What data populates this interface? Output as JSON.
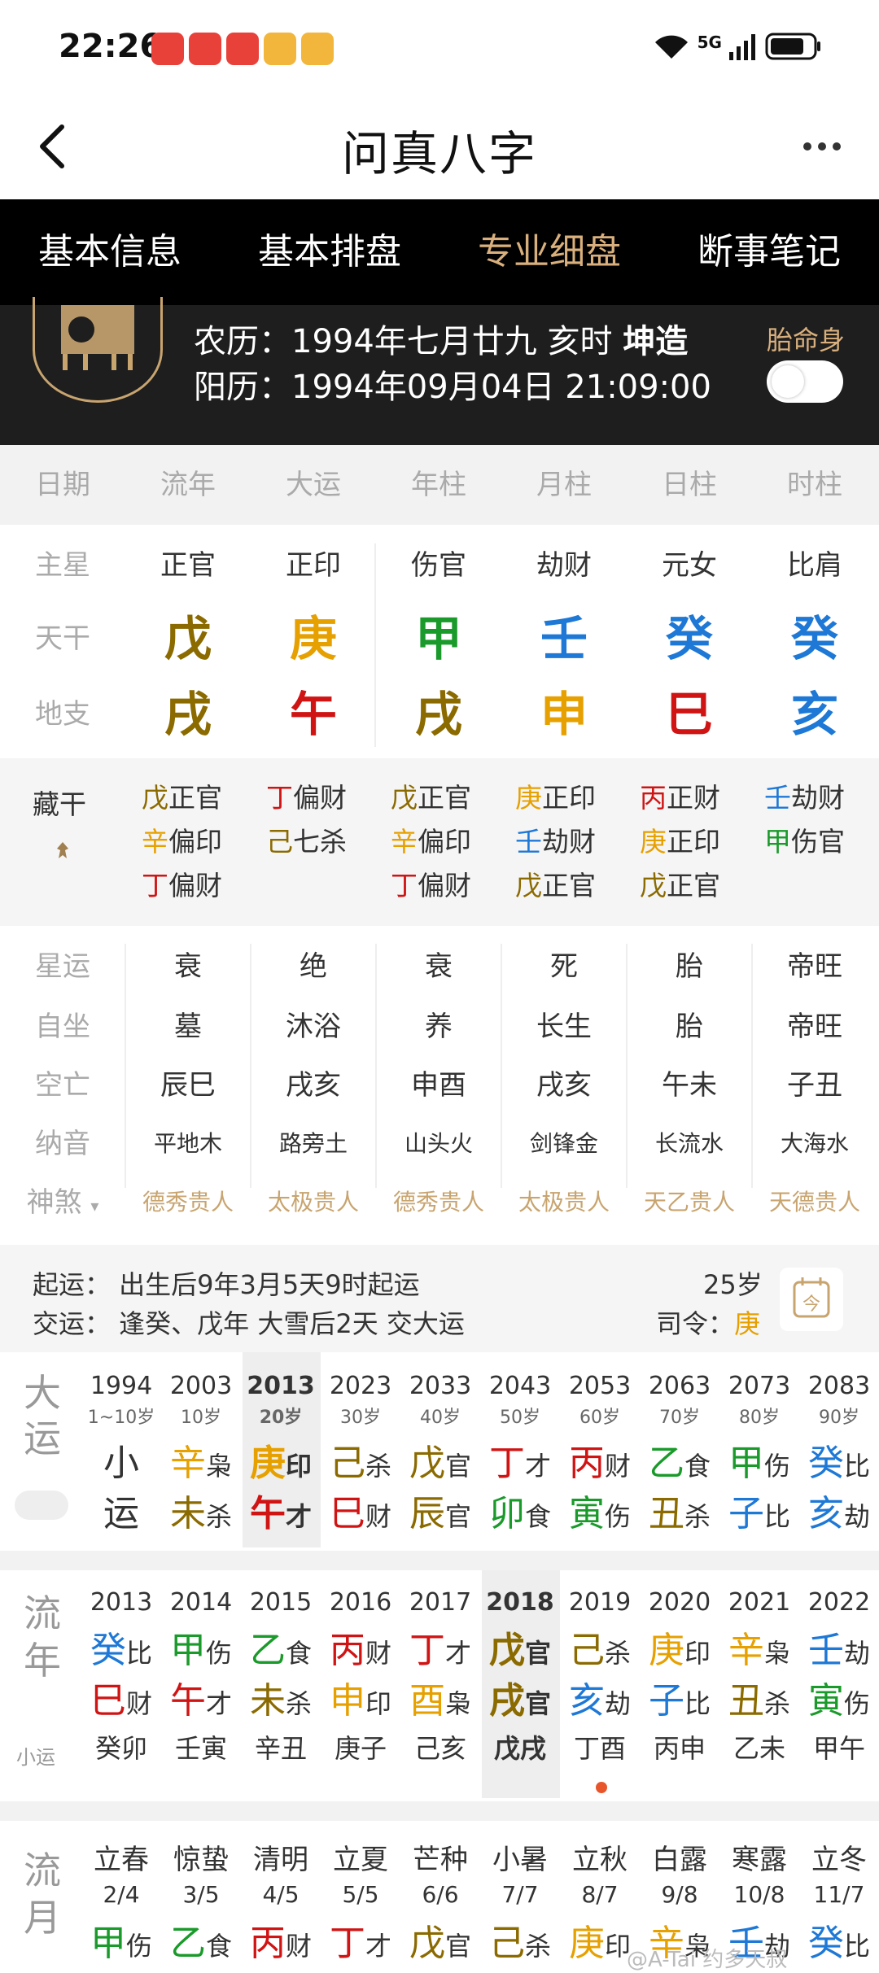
{
  "status": {
    "time": "22:26",
    "network": "5G"
  },
  "nav": {
    "title": "问真八字",
    "back_icon": "chevron-left-icon",
    "more_icon": "more-dots-icon"
  },
  "tabs": [
    "基本信息",
    "基本排盘",
    "专业细盘",
    "断事笔记"
  ],
  "header": {
    "lunar": "农历：1994年七月廿九 亥时",
    "gender": "坤造",
    "solar": "阳历：1994年09月04日 21:09:00",
    "fetal_label": "胎命身"
  },
  "columns": [
    "日期",
    "流年",
    "大运",
    "年柱",
    "月柱",
    "日柱",
    "时柱"
  ],
  "main_star": {
    "label": "主星",
    "values": [
      "正官",
      "正印",
      "伤官",
      "劫财",
      "元女",
      "比肩"
    ]
  },
  "heavenly": {
    "label": "天干",
    "values": [
      "戊",
      "庚",
      "甲",
      "壬",
      "癸",
      "癸"
    ],
    "colors": [
      "#8b6a00",
      "#e6a000",
      "#1a9a2a",
      "#1e78d6",
      "#1e78d6",
      "#1e78d6"
    ]
  },
  "earthly": {
    "label": "地支",
    "values": [
      "戌",
      "午",
      "戌",
      "申",
      "巳",
      "亥"
    ],
    "colors": [
      "#8b6a00",
      "#d01414",
      "#8b6a00",
      "#e6a000",
      "#d01414",
      "#1e78d6"
    ]
  },
  "hidden_label": "藏干",
  "hidden": [
    [
      [
        "戊",
        "正官"
      ],
      [
        "辛",
        "偏印"
      ],
      [
        "丁",
        "偏财"
      ]
    ],
    [
      [
        "丁",
        "偏财"
      ],
      [
        "己",
        "七杀"
      ]
    ],
    [
      [
        "戊",
        "正官"
      ],
      [
        "辛",
        "偏印"
      ],
      [
        "丁",
        "偏财"
      ]
    ],
    [
      [
        "庚",
        "正印"
      ],
      [
        "壬",
        "劫财"
      ],
      [
        "戊",
        "正官"
      ]
    ],
    [
      [
        "丙",
        "正财"
      ],
      [
        "庚",
        "正印"
      ],
      [
        "戊",
        "正官"
      ]
    ],
    [
      [
        "壬",
        "劫财"
      ],
      [
        "甲",
        "伤官"
      ]
    ]
  ],
  "star_luck": {
    "label": "星运",
    "values": [
      "衰",
      "绝",
      "衰",
      "死",
      "胎",
      "帝旺"
    ]
  },
  "self_seat": {
    "label": "自坐",
    "values": [
      "墓",
      "沐浴",
      "养",
      "长生",
      "胎",
      "帝旺"
    ]
  },
  "void": {
    "label": "空亡",
    "values": [
      "辰巳",
      "戌亥",
      "申酉",
      "戌亥",
      "午未",
      "子丑"
    ]
  },
  "nayin": {
    "label": "纳音",
    "values": [
      "平地木",
      "路旁土",
      "山头火",
      "剑锋金",
      "长流水",
      "大海水"
    ]
  },
  "shensha": {
    "label": "神煞",
    "values": [
      "德秀贵人",
      "太极贵人",
      "德秀贵人",
      "太极贵人",
      "天乙贵人",
      "天德贵人"
    ]
  },
  "luck_info": {
    "start": "起运：  出生后9年3月5天9时起运",
    "cross": "交运：  逢癸、戊年 大雪后2天 交大运",
    "age": "25岁",
    "siling_label": "司令：",
    "siling": "庚",
    "calendar_icon": "calendar-icon",
    "calendar_glyph": "今"
  },
  "dayun": {
    "label": "大运",
    "items": [
      {
        "year": "1994",
        "age": "1~10岁",
        "g": "小",
        "gs": "",
        "z": "运",
        "zs": ""
      },
      {
        "year": "2003",
        "age": "10岁",
        "g": "辛",
        "gs": "枭",
        "z": "未",
        "zs": "杀"
      },
      {
        "year": "2013",
        "age": "20岁",
        "g": "庚",
        "gs": "印",
        "z": "午",
        "zs": "才"
      },
      {
        "year": "2023",
        "age": "30岁",
        "g": "己",
        "gs": "杀",
        "z": "巳",
        "zs": "财"
      },
      {
        "year": "2033",
        "age": "40岁",
        "g": "戊",
        "gs": "官",
        "z": "辰",
        "zs": "官"
      },
      {
        "year": "2043",
        "age": "50岁",
        "g": "丁",
        "gs": "才",
        "z": "卯",
        "zs": "食"
      },
      {
        "year": "2053",
        "age": "60岁",
        "g": "丙",
        "gs": "财",
        "z": "寅",
        "zs": "伤"
      },
      {
        "year": "2063",
        "age": "70岁",
        "g": "乙",
        "gs": "食",
        "z": "丑",
        "zs": "杀"
      },
      {
        "year": "2073",
        "age": "80岁",
        "g": "甲",
        "gs": "伤",
        "z": "子",
        "zs": "比"
      },
      {
        "year": "2083",
        "age": "90岁",
        "g": "癸",
        "gs": "比",
        "z": "亥",
        "zs": "劫"
      }
    ]
  },
  "liunian": {
    "label": "流年",
    "sub": "小运",
    "items": [
      {
        "year": "2013",
        "g": "癸",
        "gs": "比",
        "z": "巳",
        "zs": "财",
        "x": "癸卯"
      },
      {
        "year": "2014",
        "g": "甲",
        "gs": "伤",
        "z": "午",
        "zs": "才",
        "x": "壬寅"
      },
      {
        "year": "2015",
        "g": "乙",
        "gs": "食",
        "z": "未",
        "zs": "杀",
        "x": "辛丑"
      },
      {
        "year": "2016",
        "g": "丙",
        "gs": "财",
        "z": "申",
        "zs": "印",
        "x": "庚子"
      },
      {
        "year": "2017",
        "g": "丁",
        "gs": "才",
        "z": "酉",
        "zs": "枭",
        "x": "己亥"
      },
      {
        "year": "2018",
        "g": "戊",
        "gs": "官",
        "z": "戌",
        "zs": "官",
        "x": "戊戌"
      },
      {
        "year": "2019",
        "g": "己",
        "gs": "杀",
        "z": "亥",
        "zs": "劫",
        "x": "丁酉"
      },
      {
        "year": "2020",
        "g": "庚",
        "gs": "印",
        "z": "子",
        "zs": "比",
        "x": "丙申"
      },
      {
        "year": "2021",
        "g": "辛",
        "gs": "枭",
        "z": "丑",
        "zs": "杀",
        "x": "乙未"
      },
      {
        "year": "2022",
        "g": "壬",
        "gs": "劫",
        "z": "寅",
        "zs": "伤",
        "x": "甲午"
      }
    ]
  },
  "liuyue": {
    "label": "流月",
    "items": [
      {
        "term": "立春",
        "date": "2/4",
        "g": "甲",
        "gs": "伤"
      },
      {
        "term": "惊蛰",
        "date": "3/5",
        "g": "乙",
        "gs": "食"
      },
      {
        "term": "清明",
        "date": "4/5",
        "g": "丙",
        "gs": "财"
      },
      {
        "term": "立夏",
        "date": "5/5",
        "g": "丁",
        "gs": "才"
      },
      {
        "term": "芒种",
        "date": "6/6",
        "g": "戊",
        "gs": "官"
      },
      {
        "term": "小暑",
        "date": "7/7",
        "g": "己",
        "gs": "杀"
      },
      {
        "term": "立秋",
        "date": "8/7",
        "g": "庚",
        "gs": "印"
      },
      {
        "term": "白露",
        "date": "9/8",
        "g": "辛",
        "gs": "枭"
      },
      {
        "term": "寒露",
        "date": "10/8",
        "g": "壬",
        "gs": "劫"
      },
      {
        "term": "立冬",
        "date": "11/7",
        "g": "癸",
        "gs": "比"
      }
    ]
  },
  "watermark": "@A-Tai 约多天叔",
  "colors": {
    "gold": "#d9b07d",
    "wood": "#1a9a2a",
    "fire": "#d01414",
    "earth": "#8b6a00",
    "metal": "#e6a000",
    "water": "#1e78d6"
  }
}
